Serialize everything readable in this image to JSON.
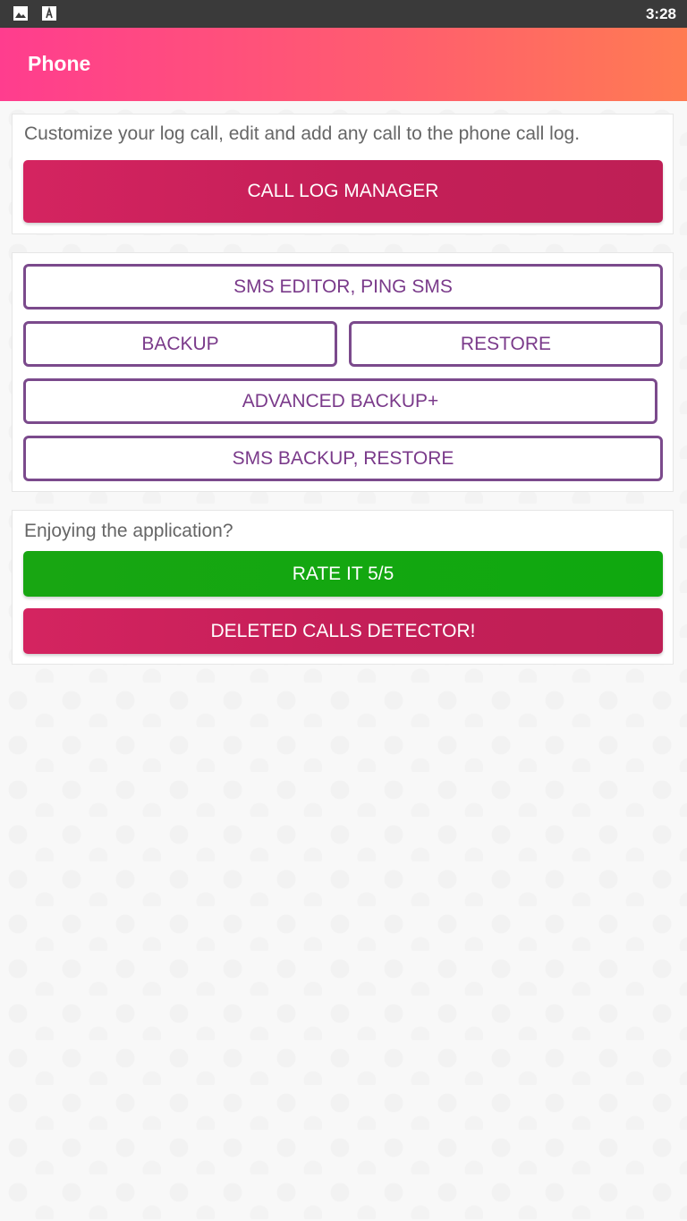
{
  "status_bar": {
    "time": "3:28",
    "icons": [
      "image-icon",
      "text-a-icon"
    ]
  },
  "app_bar": {
    "title": "Phone"
  },
  "card1": {
    "description": "Customize your log call, edit and add any call to the phone call log.",
    "call_log_manager_label": "CALL LOG MANAGER"
  },
  "card2": {
    "sms_editor_label": "SMS EDITOR, PING SMS",
    "backup_label": "BACKUP",
    "restore_label": "RESTORE",
    "advanced_backup_label": "ADVANCED BACKUP+",
    "sms_backup_restore_label": "SMS BACKUP, RESTORE"
  },
  "card3": {
    "prompt": "Enjoying the application?",
    "rate_label": "RATE IT 5/5",
    "deleted_calls_label": "DELETED CALLS DETECTOR!"
  },
  "colors": {
    "app_bar_gradient_start": "#ff3d8e",
    "app_bar_gradient_end": "#ff7b52",
    "primary_button": "#c51f58",
    "rate_button": "#10a810",
    "outline_button_border": "#7b4a8c",
    "outline_button_text": "#7a3a8a"
  }
}
